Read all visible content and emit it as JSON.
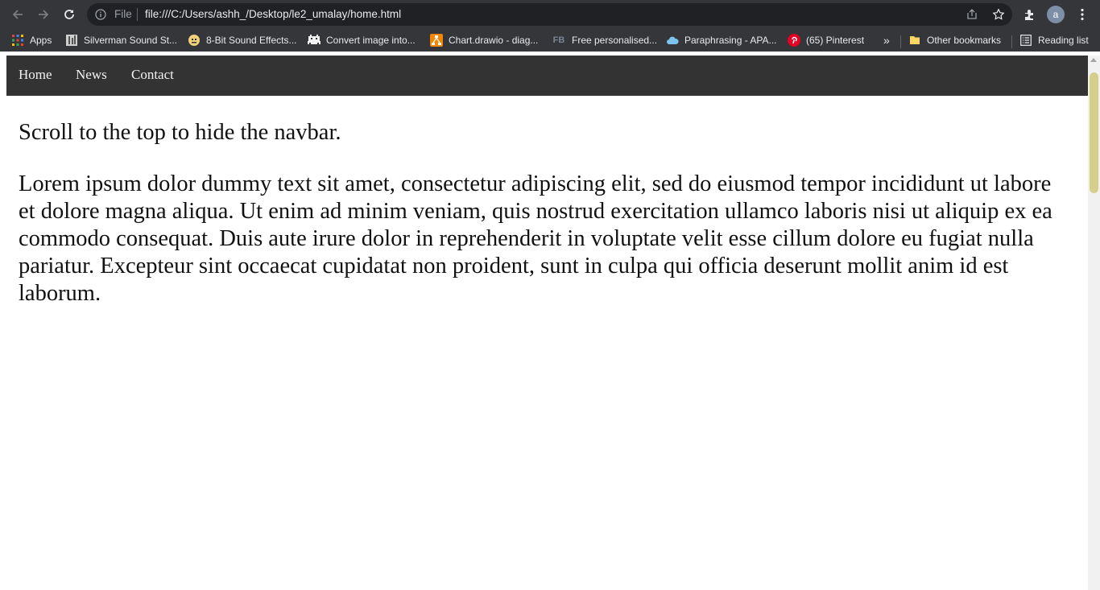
{
  "browser": {
    "url_scheme": "File",
    "url": "file:///C:/Users/ashh_/Desktop/le2_umalay/home.html",
    "avatar_letter": "a"
  },
  "bookmarks": {
    "items": [
      {
        "label": "Apps",
        "icon": "apps-grid-icon"
      },
      {
        "label": "Silverman Sound St...",
        "icon": "silverman-icon"
      },
      {
        "label": "8-Bit Sound Effects...",
        "icon": "pixel-face-icon"
      },
      {
        "label": "Convert image into...",
        "icon": "space-invader-icon"
      },
      {
        "label": "Chart.drawio - diag...",
        "icon": "drawio-icon"
      },
      {
        "label": "Free personalised...",
        "icon": "fb-icon"
      },
      {
        "label": "Paraphrasing - APA...",
        "icon": "cloud-icon"
      },
      {
        "label": "(65) Pinterest",
        "icon": "pinterest-icon"
      }
    ],
    "overflow": "»",
    "other_bookmarks": "Other bookmarks",
    "reading_list": "Reading list"
  },
  "page": {
    "nav": {
      "home": "Home",
      "news": "News",
      "contact": "Contact"
    },
    "intro": "Scroll to the top to hide the navbar.",
    "body": "Lorem ipsum dolor dummy text sit amet, consectetur adipiscing elit, sed do eiusmod tempor incididunt ut labore et dolore magna aliqua. Ut enim ad minim veniam, quis nostrud exercitation ullamco laboris nisi ut aliquip ex ea commodo consequat. Duis aute irure dolor in reprehenderit in voluptate velit esse cillum dolore eu fugiat nulla pariatur. Excepteur sint occaecat cupidatat non proident, sunt in culpa qui officia deserunt mollit anim id est laborum."
  },
  "colors": {
    "toolbar": "#35363a",
    "omnibox": "#202124",
    "navbar": "#333333",
    "scroll_thumb": "#d6cf8c"
  }
}
